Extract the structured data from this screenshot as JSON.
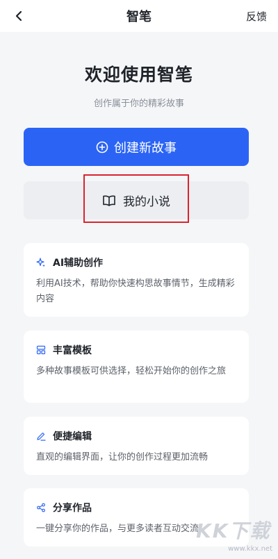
{
  "header": {
    "title": "智笔",
    "feedback_label": "反馈"
  },
  "hero": {
    "title": "欢迎使用智笔",
    "subtitle": "创作属于你的精彩故事"
  },
  "actions": {
    "create_label": "创建新故事",
    "my_novels_label": "我的小说"
  },
  "features": [
    {
      "title": "AI辅助创作",
      "desc": "利用AI技术，帮助你快速构思故事情节，生成精彩内容",
      "icon": "sparkle-icon"
    },
    {
      "title": "丰富模板",
      "desc": "多种故事模板可供选择，轻松开始你的创作之旅",
      "icon": "template-icon"
    },
    {
      "title": "便捷编辑",
      "desc": "直观的编辑界面，让你的创作过程更加流畅",
      "icon": "pencil-icon"
    },
    {
      "title": "分享作品",
      "desc": "一键分享你的作品，与更多读者互动交流",
      "icon": "share-icon"
    }
  ],
  "watermark": {
    "text": "KK下载",
    "url": "www.kkx.net"
  },
  "colors": {
    "primary": "#2b64f5",
    "highlight": "#d9232e",
    "background": "#f5f6f8"
  }
}
